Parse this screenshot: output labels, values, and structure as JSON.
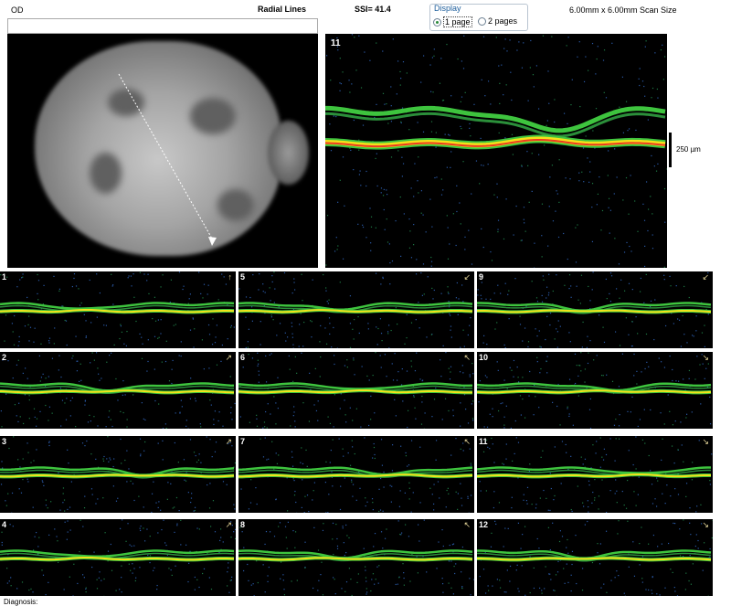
{
  "header": {
    "eye": "OD",
    "scan_name": "Radial Lines",
    "ssi": "SSI= 41.4",
    "scan_size": "6.00mm x 6.00mm Scan Size"
  },
  "display": {
    "legend": "Display",
    "options": [
      {
        "label": "1 page",
        "selected": true
      },
      {
        "label": "2 pages",
        "selected": false
      }
    ]
  },
  "main_scan": {
    "number": "11",
    "scale_label": "250 µm"
  },
  "thumbnails": [
    {
      "number": "1",
      "arrow": "↑"
    },
    {
      "number": "5",
      "arrow": "↙"
    },
    {
      "number": "9",
      "arrow": "↙"
    },
    {
      "number": "2",
      "arrow": "↗"
    },
    {
      "number": "6",
      "arrow": "↖"
    },
    {
      "number": "10",
      "arrow": "↘"
    },
    {
      "number": "3",
      "arrow": "↗"
    },
    {
      "number": "7",
      "arrow": "↖"
    },
    {
      "number": "11",
      "arrow": "↘"
    },
    {
      "number": "4",
      "arrow": "↗"
    },
    {
      "number": "8",
      "arrow": "↖"
    },
    {
      "number": "12",
      "arrow": "↘"
    }
  ],
  "footer": {
    "diagnosis_label": "Diagnosis:"
  },
  "colors": {
    "retina_green": "#3ec43e",
    "retina_yellow": "#f2e21a",
    "retina_red": "#ee3a22",
    "noise_blue": "#2a59a6"
  }
}
